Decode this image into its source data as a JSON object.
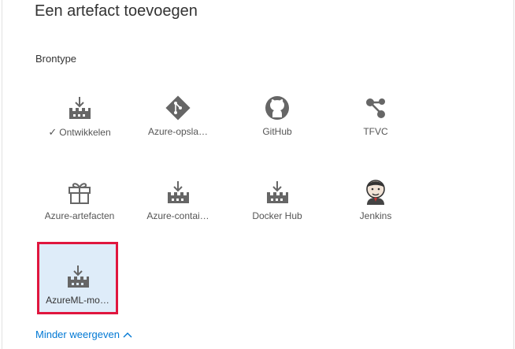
{
  "title": "Een artefact toevoegen",
  "source_type_label": "Brontype",
  "tiles": [
    {
      "label": "Ontwikkelen",
      "icon": "build-icon",
      "checked": true
    },
    {
      "label": "Azure-opsla…",
      "icon": "azure-repos-git-icon"
    },
    {
      "label": "GitHub",
      "icon": "github-icon"
    },
    {
      "label": "TFVC",
      "icon": "tfvc-icon"
    },
    {
      "label": "Azure-artefacten",
      "icon": "azure-artifacts-icon"
    },
    {
      "label": "Azure-contai…",
      "icon": "azure-container-icon"
    },
    {
      "label": "Docker Hub",
      "icon": "docker-hub-icon"
    },
    {
      "label": "Jenkins",
      "icon": "jenkins-icon"
    },
    {
      "label": "AzureML-mo…",
      "icon": "azureml-model-icon",
      "selected": true
    }
  ],
  "show_less_label": "Minder weergeven",
  "colors": {
    "accent": "#0078d4",
    "highlight": "#e0163e",
    "selected_bg": "#deecf9"
  }
}
